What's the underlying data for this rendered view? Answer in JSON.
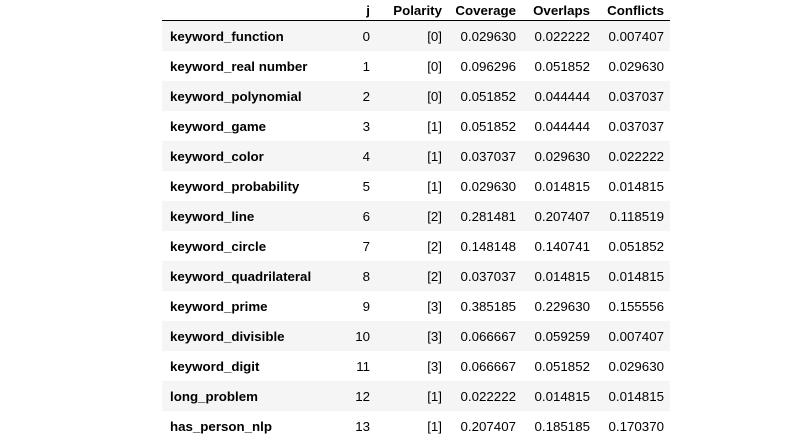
{
  "table": {
    "columns": [
      "",
      "j",
      "Polarity",
      "Coverage",
      "Overlaps",
      "Conflicts"
    ],
    "rows": [
      {
        "name": "keyword_function",
        "j": "0",
        "polarity": "[0]",
        "coverage": "0.029630",
        "overlaps": "0.022222",
        "conflicts": "0.007407"
      },
      {
        "name": "keyword_real number",
        "j": "1",
        "polarity": "[0]",
        "coverage": "0.096296",
        "overlaps": "0.051852",
        "conflicts": "0.029630"
      },
      {
        "name": "keyword_polynomial",
        "j": "2",
        "polarity": "[0]",
        "coverage": "0.051852",
        "overlaps": "0.044444",
        "conflicts": "0.037037"
      },
      {
        "name": "keyword_game",
        "j": "3",
        "polarity": "[1]",
        "coverage": "0.051852",
        "overlaps": "0.044444",
        "conflicts": "0.037037"
      },
      {
        "name": "keyword_color",
        "j": "4",
        "polarity": "[1]",
        "coverage": "0.037037",
        "overlaps": "0.029630",
        "conflicts": "0.022222"
      },
      {
        "name": "keyword_probability",
        "j": "5",
        "polarity": "[1]",
        "coverage": "0.029630",
        "overlaps": "0.014815",
        "conflicts": "0.014815"
      },
      {
        "name": "keyword_line",
        "j": "6",
        "polarity": "[2]",
        "coverage": "0.281481",
        "overlaps": "0.207407",
        "conflicts": "0.118519"
      },
      {
        "name": "keyword_circle",
        "j": "7",
        "polarity": "[2]",
        "coverage": "0.148148",
        "overlaps": "0.140741",
        "conflicts": "0.051852"
      },
      {
        "name": "keyword_quadrilateral",
        "j": "8",
        "polarity": "[2]",
        "coverage": "0.037037",
        "overlaps": "0.014815",
        "conflicts": "0.014815"
      },
      {
        "name": "keyword_prime",
        "j": "9",
        "polarity": "[3]",
        "coverage": "0.385185",
        "overlaps": "0.229630",
        "conflicts": "0.155556"
      },
      {
        "name": "keyword_divisible",
        "j": "10",
        "polarity": "[3]",
        "coverage": "0.066667",
        "overlaps": "0.059259",
        "conflicts": "0.007407"
      },
      {
        "name": "keyword_digit",
        "j": "11",
        "polarity": "[3]",
        "coverage": "0.066667",
        "overlaps": "0.051852",
        "conflicts": "0.029630"
      },
      {
        "name": "long_problem",
        "j": "12",
        "polarity": "[1]",
        "coverage": "0.022222",
        "overlaps": "0.014815",
        "conflicts": "0.014815"
      },
      {
        "name": "has_person_nlp",
        "j": "13",
        "polarity": "[1]",
        "coverage": "0.207407",
        "overlaps": "0.185185",
        "conflicts": "0.170370"
      }
    ]
  }
}
